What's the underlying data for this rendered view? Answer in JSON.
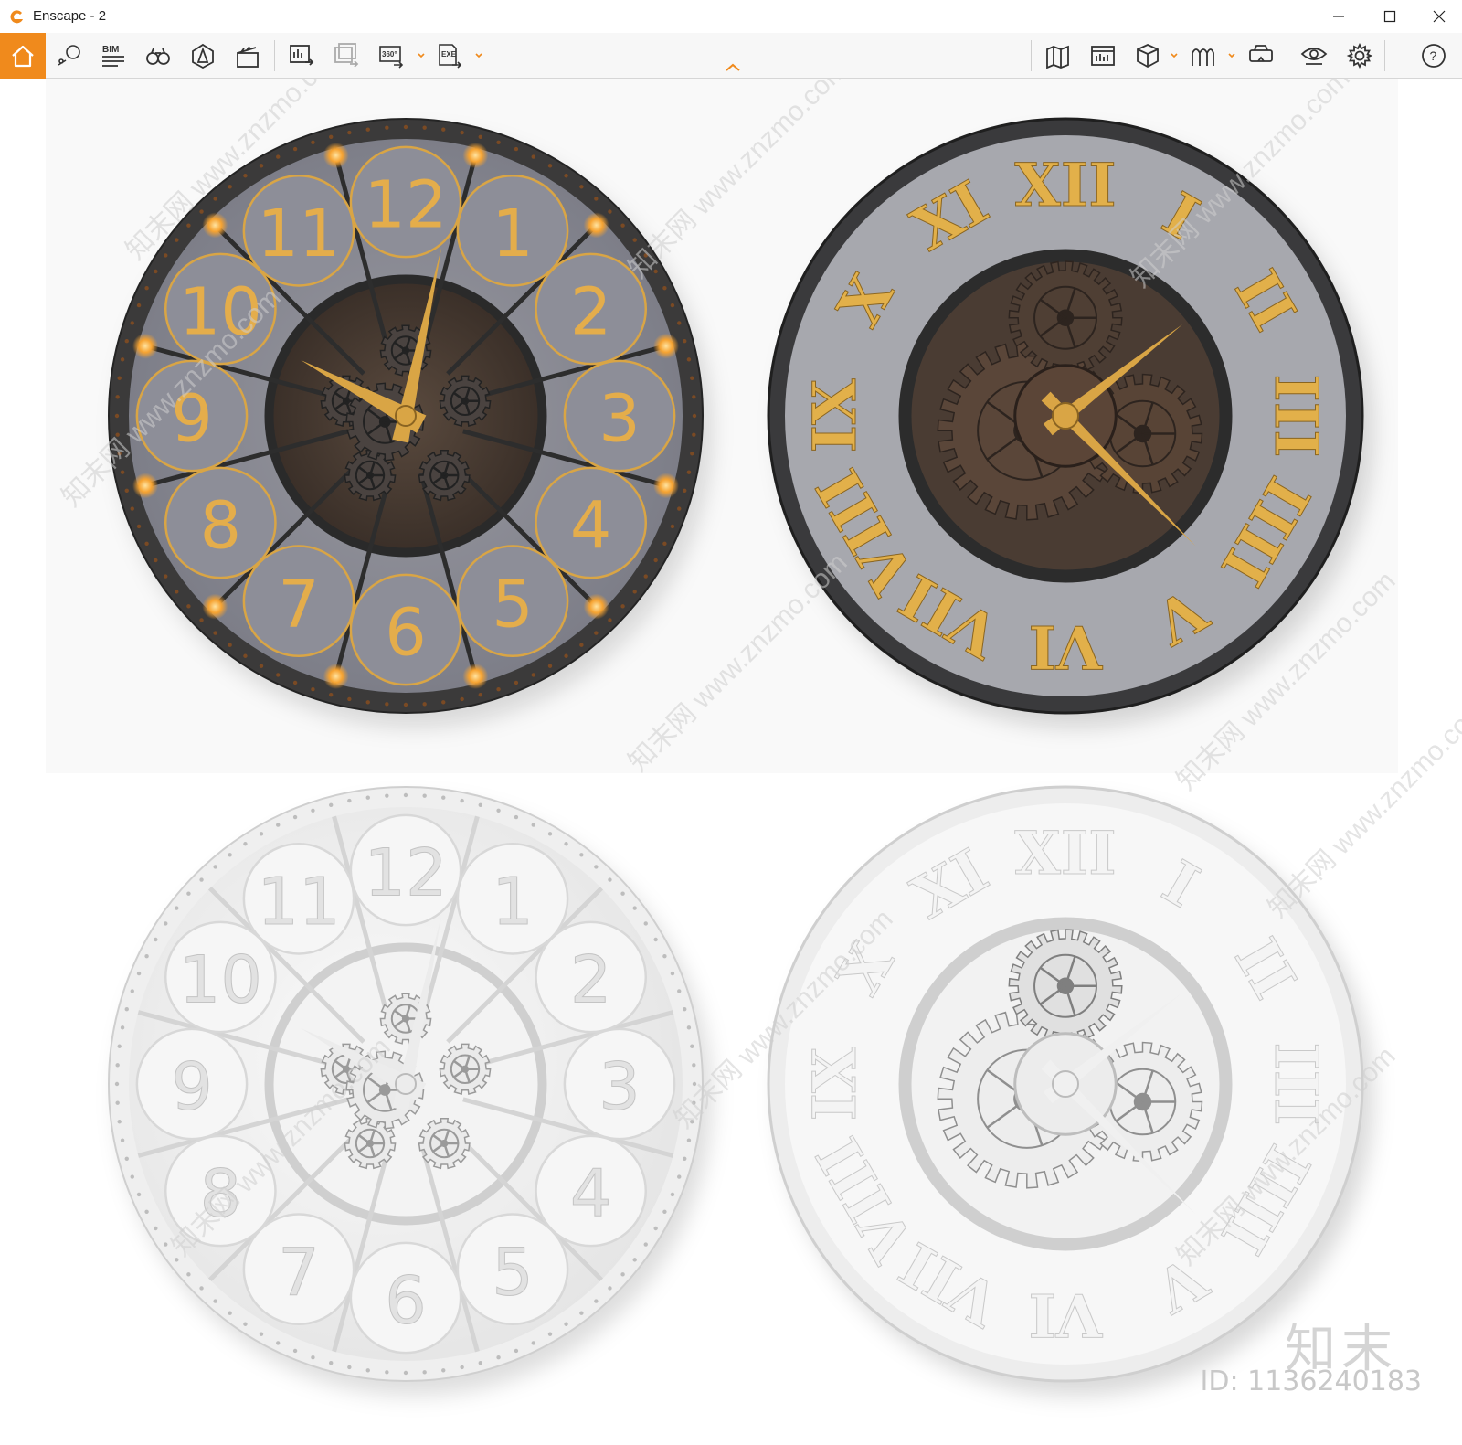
{
  "window": {
    "title": "Enscape - 2",
    "controls": [
      "minimize",
      "maximize",
      "close"
    ]
  },
  "toolbar": {
    "accent": "#f08a1c",
    "left_tools": [
      {
        "name": "home-icon",
        "active": true
      },
      {
        "name": "views-icon"
      },
      {
        "name": "bim-icon",
        "label": "BIM"
      },
      {
        "name": "binoculars-icon"
      },
      {
        "name": "asset-library-icon"
      },
      {
        "name": "video-editor-icon"
      },
      {
        "name": "screenshot-export-icon"
      },
      {
        "name": "batch-render-icon"
      },
      {
        "name": "panorama-export-icon",
        "label": "360°"
      },
      {
        "name": "exe-export-icon",
        "label": "EXE"
      }
    ],
    "right_tools": [
      {
        "name": "map-icon"
      },
      {
        "name": "minimap-icon"
      },
      {
        "name": "cube-icon"
      },
      {
        "name": "atmosphere-icon"
      },
      {
        "name": "vr-headset-icon"
      },
      {
        "name": "eye-icon"
      },
      {
        "name": "settings-icon"
      },
      {
        "name": "help-icon",
        "label": "?"
      }
    ]
  },
  "viewport": {
    "content": "four wall clock renders",
    "clocks": [
      {
        "style": "arabic",
        "numerals": [
          "12",
          "1",
          "2",
          "3",
          "4",
          "5",
          "6",
          "7",
          "8",
          "9",
          "10",
          "11"
        ],
        "render": "color"
      },
      {
        "style": "roman",
        "numerals": [
          "XII",
          "I",
          "II",
          "III",
          "IIII",
          "V",
          "VI",
          "VII",
          "VIII",
          "IX",
          "X",
          "XI"
        ],
        "render": "color"
      },
      {
        "style": "arabic",
        "render": "white-model"
      },
      {
        "style": "roman",
        "render": "white-model"
      }
    ],
    "watermark": "知末网 www.znzmo.com",
    "brand": "知末",
    "image_id": "ID: 1136240183"
  }
}
